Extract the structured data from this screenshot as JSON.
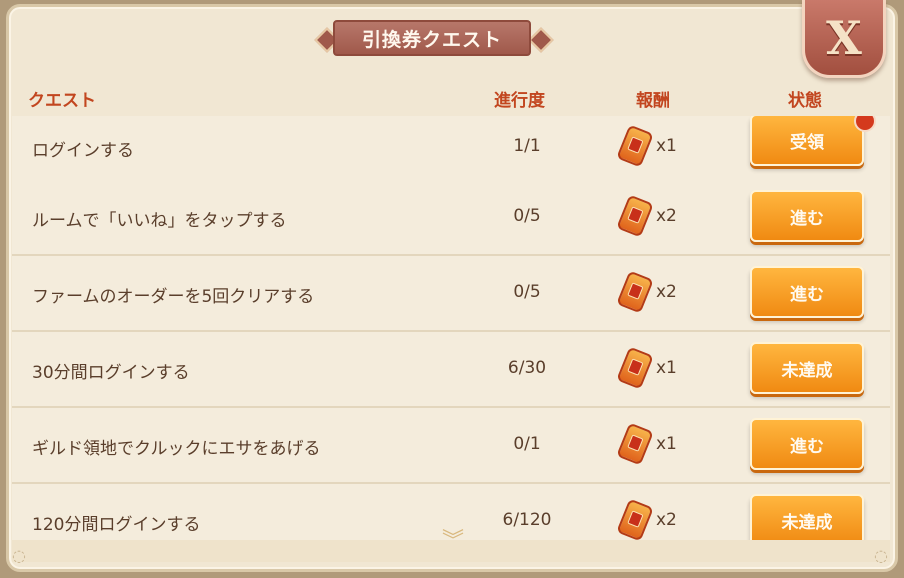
{
  "title": "引換券クエスト",
  "close_label": "X",
  "headers": {
    "quest": "クエスト",
    "progress": "進行度",
    "reward": "報酬",
    "status": "状態"
  },
  "rows": [
    {
      "name": "ログインする",
      "progress": "1/1",
      "reward": "x1",
      "status": "受領",
      "badge": true
    },
    {
      "name": "ルームで「いいね」をタップする",
      "progress": "0/5",
      "reward": "x2",
      "status": "進む"
    },
    {
      "name": "ファームのオーダーを5回クリアする",
      "progress": "0/5",
      "reward": "x2",
      "status": "進む"
    },
    {
      "name": "30分間ログインする",
      "progress": "6/30",
      "reward": "x1",
      "status": "未達成"
    },
    {
      "name": "ギルド領地でクルックにエサをあげる",
      "progress": "0/1",
      "reward": "x1",
      "status": "進む"
    },
    {
      "name": "120分間ログインする",
      "progress": "6/120",
      "reward": "x2",
      "status": "未達成"
    }
  ],
  "colors": {
    "header_text": "#c2461f",
    "button": "#f08a12",
    "title_bar": "#a0594b"
  },
  "icons": {
    "reward": "ticket-icon",
    "scroll": "chevron-down-icon",
    "close": "close-icon"
  }
}
